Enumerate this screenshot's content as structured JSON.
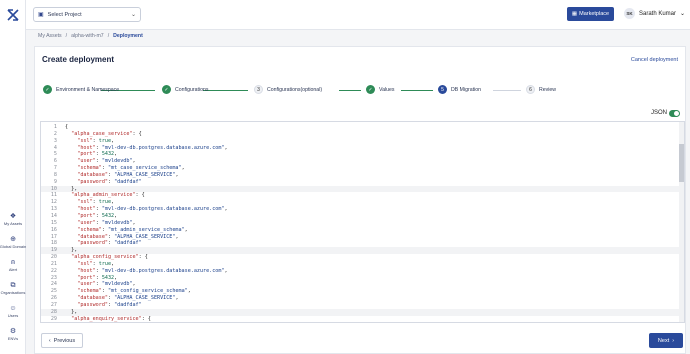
{
  "topbar": {
    "project_placeholder": "Select Project",
    "marketplace": "Marketplace",
    "user_initials": "SK",
    "user_name": "Sarath Kumar"
  },
  "breadcrumb": [
    "My Assets",
    "/",
    "alpha-with-m7",
    "/",
    "Deployment"
  ],
  "sidebar": {
    "items": [
      {
        "icon": "assets-icon",
        "glyph": "❖",
        "label": "My Assets"
      },
      {
        "icon": "globe-icon",
        "glyph": "⊕",
        "label": "Global Domain"
      },
      {
        "icon": "bell-icon",
        "glyph": "⍝",
        "label": "Alert"
      },
      {
        "icon": "org-icon",
        "glyph": "⧉",
        "label": "Organisations"
      },
      {
        "icon": "users-icon",
        "glyph": "☺",
        "label": "Users"
      },
      {
        "icon": "env-icon",
        "glyph": "⚙",
        "label": "ENVs"
      }
    ]
  },
  "page": {
    "title": "Create deployment",
    "cancel": "Cancel deployment",
    "json_label": "JSON",
    "prev": "Previous",
    "next": "Next"
  },
  "steps": [
    {
      "label": "Environment & Namespace",
      "state": "done",
      "num": "✓"
    },
    {
      "label": "Configurations",
      "state": "done",
      "num": "✓"
    },
    {
      "label": "Configurations(optional)",
      "state": "todo",
      "num": "3"
    },
    {
      "label": "Values",
      "state": "done",
      "num": "✓"
    },
    {
      "label": "DB Migration",
      "state": "active",
      "num": "5"
    },
    {
      "label": "Review",
      "state": "todo",
      "num": "6"
    }
  ],
  "code_lines": [
    {
      "n": "1",
      "t": "{"
    },
    {
      "n": "2",
      "t": "  \"alpha_case_service\": {"
    },
    {
      "n": "3",
      "t": "    \"ssl\": true,"
    },
    {
      "n": "4",
      "t": "    \"host\": \"mvl-dev-db.postgres.database.azure.com\","
    },
    {
      "n": "5",
      "t": "    \"port\": 5432,"
    },
    {
      "n": "6",
      "t": "    \"user\": \"mvldevdb\","
    },
    {
      "n": "7",
      "t": "    \"schema\": \"mt_case_service_schema\","
    },
    {
      "n": "8",
      "t": "    \"database\": \"ALPHA_CASE_SERVICE\","
    },
    {
      "n": "9",
      "t": "    \"password\": \"dadfdaf\""
    },
    {
      "n": "10",
      "t": "  },"
    },
    {
      "n": "11",
      "t": "  \"alpha_admin_service\": {"
    },
    {
      "n": "12",
      "t": "    \"ssl\": true,"
    },
    {
      "n": "13",
      "t": "    \"host\": \"mvl-dev-db.postgres.database.azure.com\","
    },
    {
      "n": "14",
      "t": "    \"port\": 5432,"
    },
    {
      "n": "15",
      "t": "    \"user\": \"mvldevdb\","
    },
    {
      "n": "16",
      "t": "    \"schema\": \"mt_admin_service_schema\","
    },
    {
      "n": "17",
      "t": "    \"database\": \"ALPHA_CASE_SERVICE\","
    },
    {
      "n": "18",
      "t": "    \"password\": \"dadfdaf\""
    },
    {
      "n": "19",
      "t": "  },"
    },
    {
      "n": "20",
      "t": "  \"alpha_config_service\": {"
    },
    {
      "n": "21",
      "t": "    \"ssl\": true,"
    },
    {
      "n": "22",
      "t": "    \"host\": \"mvl-dev-db.postgres.database.azure.com\","
    },
    {
      "n": "23",
      "t": "    \"port\": 5432,"
    },
    {
      "n": "24",
      "t": "    \"user\": \"mvldevdb\","
    },
    {
      "n": "25",
      "t": "    \"schema\": \"mt_config_service_schema\","
    },
    {
      "n": "26",
      "t": "    \"database\": \"ALPHA_CASE_SERVICE\","
    },
    {
      "n": "27",
      "t": "    \"password\": \"dadfdaf\""
    },
    {
      "n": "28",
      "t": "  },"
    },
    {
      "n": "29",
      "t": "  \"alpha_enquiry_service\": {"
    }
  ]
}
